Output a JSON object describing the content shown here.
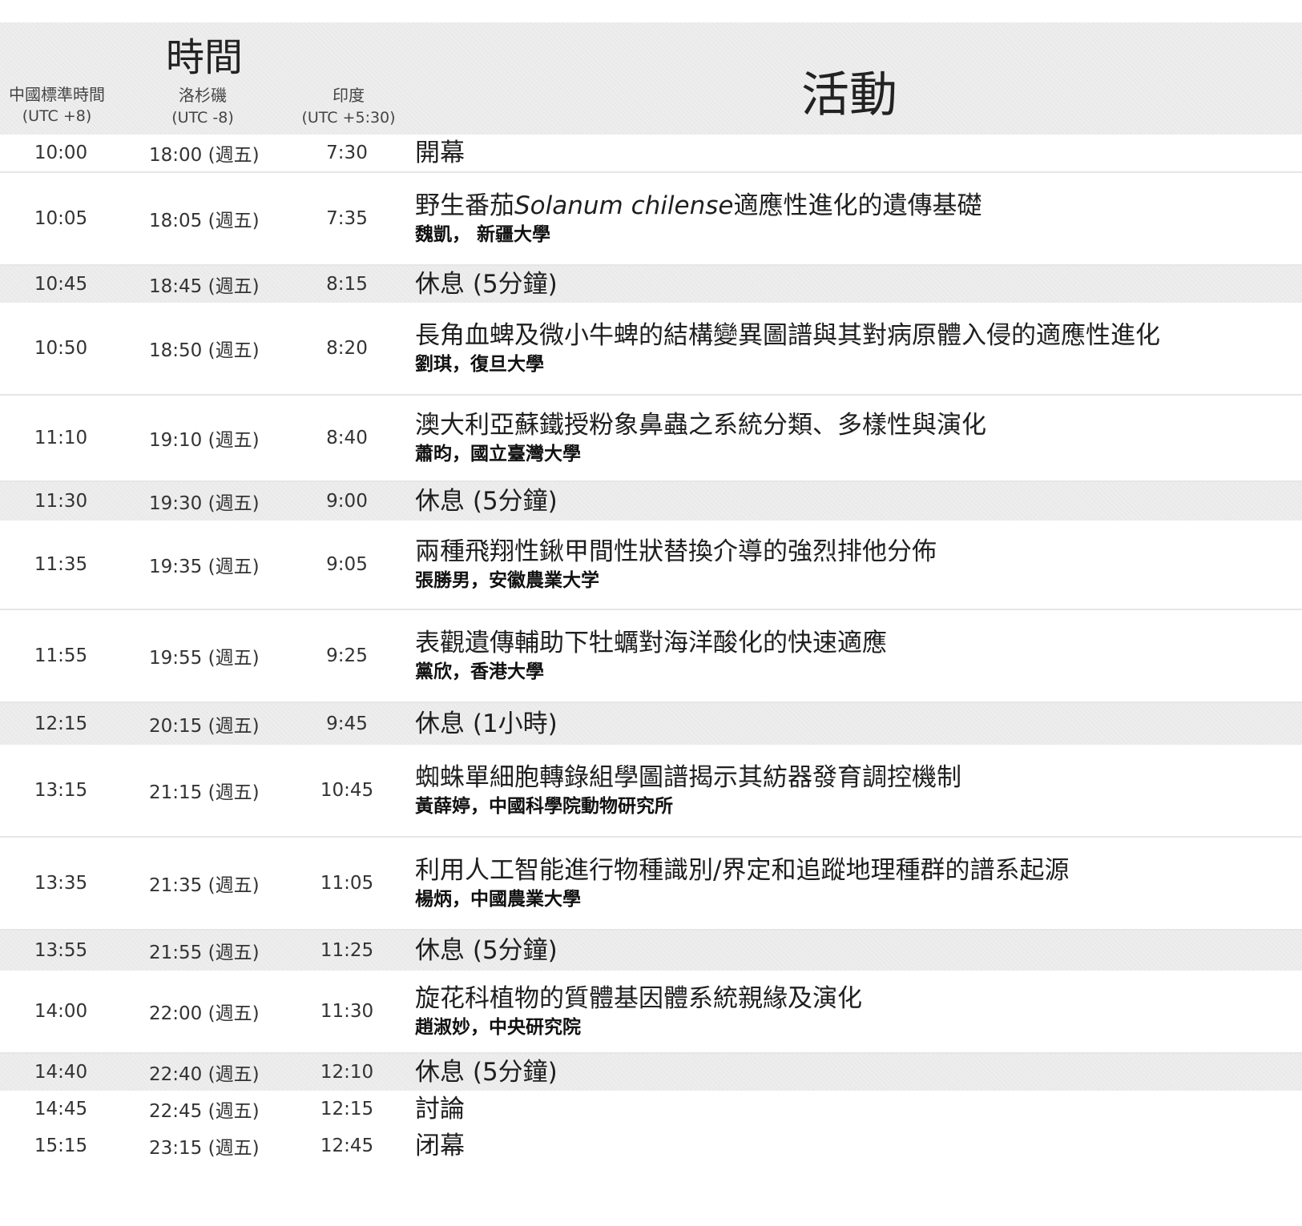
{
  "header": {
    "time_title": "時間",
    "activity_title": "活動",
    "col_china_label": "中國標準時間",
    "col_china_tz": "(UTC +8)",
    "col_la_label": "洛杉磯",
    "col_la_tz": "(UTC -8)",
    "col_india_label": "印度",
    "col_india_tz": "(UTC +5:30)"
  },
  "rows": [
    {
      "china": "10:00",
      "la": "18:00 (週五)",
      "india": "7:30",
      "title": "開幕",
      "speaker": "",
      "kind": "plain"
    },
    {
      "china": "10:05",
      "la": "18:05 (週五)",
      "india": "7:35",
      "title_before": "野生番茄",
      "title_italic": "Solanum chilense",
      "title_after": "適應性進化的遺傳基礎",
      "speaker": "魏凱， 新疆大學",
      "kind": "talk"
    },
    {
      "china": "10:45",
      "la": "18:45 (週五)",
      "india": "8:15",
      "title": "休息 (5分鐘)",
      "speaker": "",
      "kind": "break"
    },
    {
      "china": "10:50",
      "la": "18:50 (週五)",
      "india": "8:20",
      "title": "長角血蜱及微小牛蜱的結構變異圖譜與其對病原體入侵的適應性進化",
      "speaker": "劉琪，復旦大學",
      "kind": "talk"
    },
    {
      "china": "11:10",
      "la": "19:10 (週五)",
      "india": "8:40",
      "title": "澳大利亞蘇鐵授粉象鼻蟲之系統分類、多樣性與演化",
      "speaker": "蕭昀，國立臺灣大學",
      "kind": "talk"
    },
    {
      "china": "11:30",
      "la": "19:30 (週五)",
      "india": "9:00",
      "title": "休息 (5分鐘)",
      "speaker": "",
      "kind": "break"
    },
    {
      "china": "11:35",
      "la": "19:35 (週五)",
      "india": "9:05",
      "title": "兩種飛翔性鍬甲間性狀替換介導的強烈排他分佈",
      "speaker": "張勝男，安徽農業大学",
      "kind": "talk"
    },
    {
      "china": "11:55",
      "la": "19:55 (週五)",
      "india": "9:25",
      "title": "表觀遺傳輔助下牡蠣對海洋酸化的快速適應",
      "speaker": "黨欣，香港大學",
      "kind": "talk"
    },
    {
      "china": "12:15",
      "la": "20:15 (週五)",
      "india": "9:45",
      "title": "休息 (1小時)",
      "speaker": "",
      "kind": "break"
    },
    {
      "china": "13:15",
      "la": "21:15 (週五)",
      "india": "10:45",
      "title": "蜘蛛單細胞轉錄組學圖譜揭示其紡器發育調控機制",
      "speaker": "黃薛婷，中國科學院動物研究所",
      "kind": "talk"
    },
    {
      "china": "13:35",
      "la": "21:35 (週五)",
      "india": "11:05",
      "title": "利用人工智能進行物種識別/界定和追蹤地理種群的譜系起源",
      "speaker": "楊炳，中國農業大學",
      "kind": "talk"
    },
    {
      "china": "13:55",
      "la": "21:55 (週五)",
      "india": "11:25",
      "title": "休息 (5分鐘)",
      "speaker": "",
      "kind": "break"
    },
    {
      "china": "14:00",
      "la": "22:00 (週五)",
      "india": "11:30",
      "title": "旋花科植物的質體基因體系統親緣及演化",
      "speaker": "趙淑妙，中央研究院",
      "kind": "talk"
    },
    {
      "china": "14:40",
      "la": "22:40 (週五)",
      "india": "12:10",
      "title": "休息 (5分鐘)",
      "speaker": "",
      "kind": "break"
    },
    {
      "china": "14:45",
      "la": "22:45 (週五)",
      "india": "12:15",
      "title": "討論",
      "speaker": "",
      "kind": "plain"
    },
    {
      "china": "15:15",
      "la": "23:15 (週五)",
      "india": "12:45",
      "title": "闭幕",
      "speaker": "",
      "kind": "plain"
    }
  ]
}
